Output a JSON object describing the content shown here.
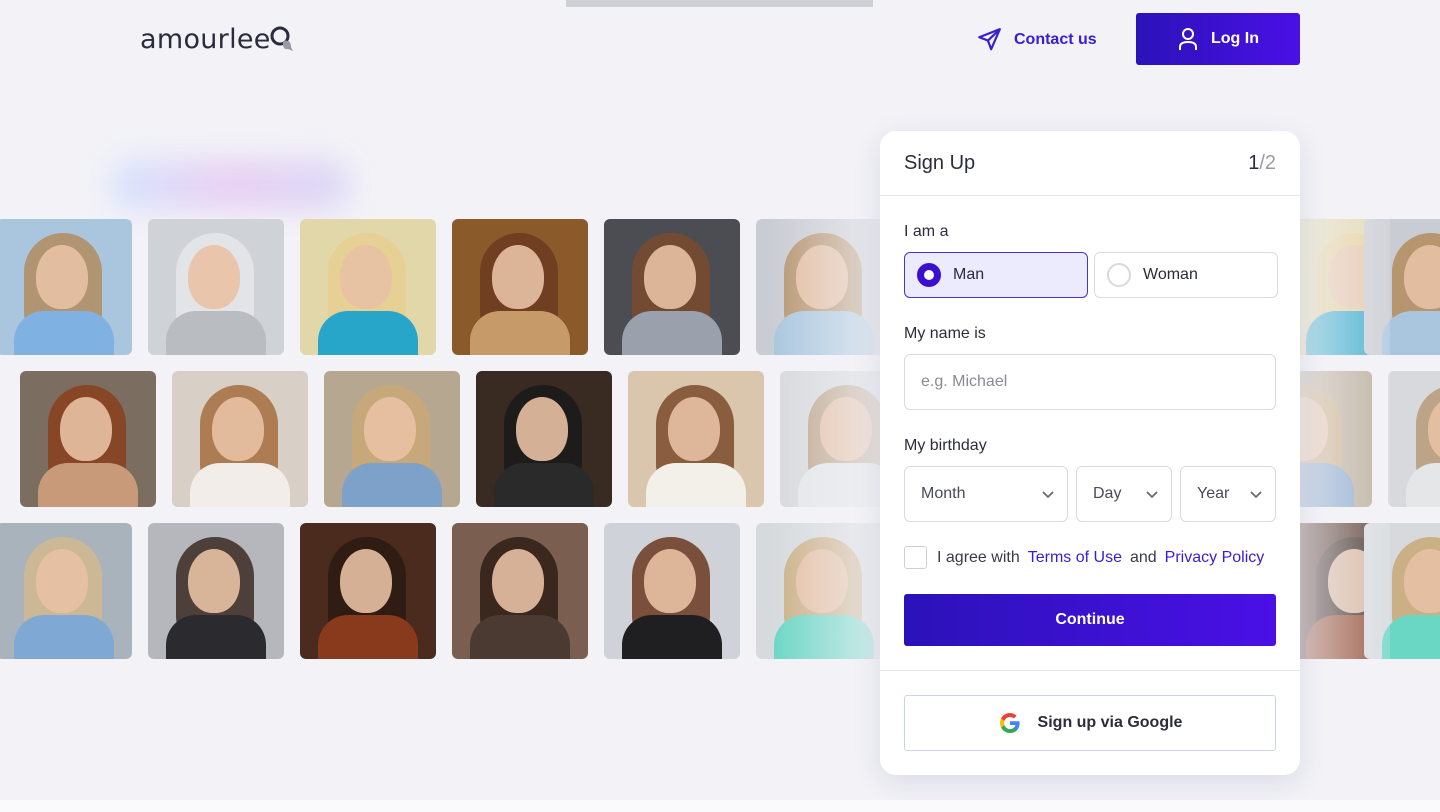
{
  "header": {
    "logo_text": "amourlee",
    "contact_label": "Contact us",
    "login_label": "Log In"
  },
  "signup": {
    "title": "Sign Up",
    "step_current": "1",
    "step_total": "/2",
    "gender_label": "I am a",
    "gender_options": [
      {
        "label": "Man",
        "selected": true
      },
      {
        "label": "Woman",
        "selected": false
      }
    ],
    "name_label": "My name is",
    "name_placeholder": "e.g. Michael",
    "birthday_label": "My birthday",
    "month_label": "Month",
    "day_label": "Day",
    "year_label": "Year",
    "agree_prefix": "I agree with",
    "terms_label": "Terms of Use",
    "agree_and": "and",
    "privacy_label": "Privacy Policy",
    "continue_label": "Continue",
    "google_label": "Sign up via Google"
  },
  "colors": {
    "accent": "#3a1dd0",
    "button_gradient_start": "#2b12b8",
    "button_gradient_end": "#4a10e6",
    "background": "#f2f2f7"
  },
  "gallery": {
    "photos": [
      {
        "bg": "#a9c6de",
        "hair": "#b38b5e",
        "body": "#7fb2e2"
      },
      {
        "bg": "#cfd2d6",
        "hair": "#e6e8ea",
        "body": "#b9bcc0"
      },
      {
        "bg": "#e2d7a8",
        "hair": "#e7cf91",
        "body": "#28a6c9"
      },
      {
        "bg": "#8b5a2b",
        "hair": "#6b3a1e",
        "body": "#c79a6a"
      },
      {
        "bg": "#4c4d53",
        "hair": "#7a4b2e",
        "body": "#9aa1ad"
      },
      {
        "bg": "#c9ccd2",
        "hair": "#b38b5e",
        "body": "#a9c6de"
      },
      {
        "bg": "#7b6d60",
        "hair": "#8a3f1c",
        "body": "#c99a7a"
      },
      {
        "bg": "#d8cfc6",
        "hair": "#a66d3d",
        "body": "#f2ede8"
      },
      {
        "bg": "#b6a790",
        "hair": "#c9a877",
        "body": "#7da1c8"
      },
      {
        "bg": "#3a2b22",
        "hair": "#1a1a1a",
        "body": "#2a2a2a"
      },
      {
        "bg": "#d9c6ad",
        "hair": "#7a4a2a",
        "body": "#f3efe9"
      },
      {
        "bg": "#d7d9dc",
        "hair": "#b89a7a",
        "body": "#e4e6e8"
      },
      {
        "bg": "#a9b3bc",
        "hair": "#d3b88e",
        "body": "#7fa8d4"
      },
      {
        "bg": "#b6b7bc",
        "hair": "#3b2a22",
        "body": "#2a2a2f"
      },
      {
        "bg": "#4a2b1e",
        "hair": "#2a1a12",
        "body": "#8a3a1c"
      },
      {
        "bg": "#7a5e50",
        "hair": "#2f1d15",
        "body": "#4a3a32"
      },
      {
        "bg": "#cfd2d8",
        "hair": "#6b3a22",
        "body": "#1f1f22"
      },
      {
        "bg": "#d6dadd",
        "hair": "#c9a877",
        "body": "#6ad6c4"
      }
    ]
  }
}
